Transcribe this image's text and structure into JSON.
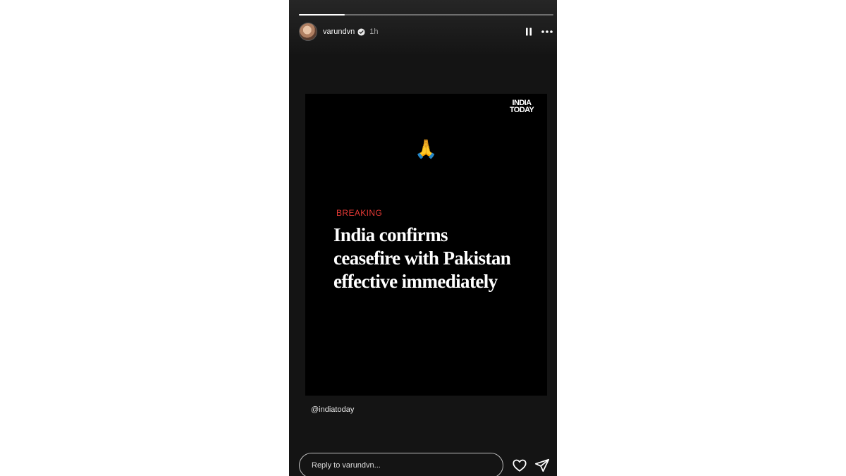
{
  "story": {
    "progress": 0.18,
    "author": {
      "username": "varundvn",
      "verified": true,
      "posted_ago": "1h"
    },
    "controls": {
      "pause_icon": "pause-icon",
      "more_icon": "more-options-icon"
    }
  },
  "content": {
    "brand_logo": [
      "INDIA",
      "TODAY"
    ],
    "emoji": "🙏",
    "kicker": "BREAKING",
    "headline_lines": [
      "India confirms",
      "ceasefire with Pakistan",
      "effective immediately"
    ],
    "kicker_color": "#e53935"
  },
  "mention": "@indiatoday",
  "footer": {
    "reply_placeholder": "Reply to varundvn...",
    "like_icon": "heart-icon",
    "share_icon": "send-icon"
  }
}
